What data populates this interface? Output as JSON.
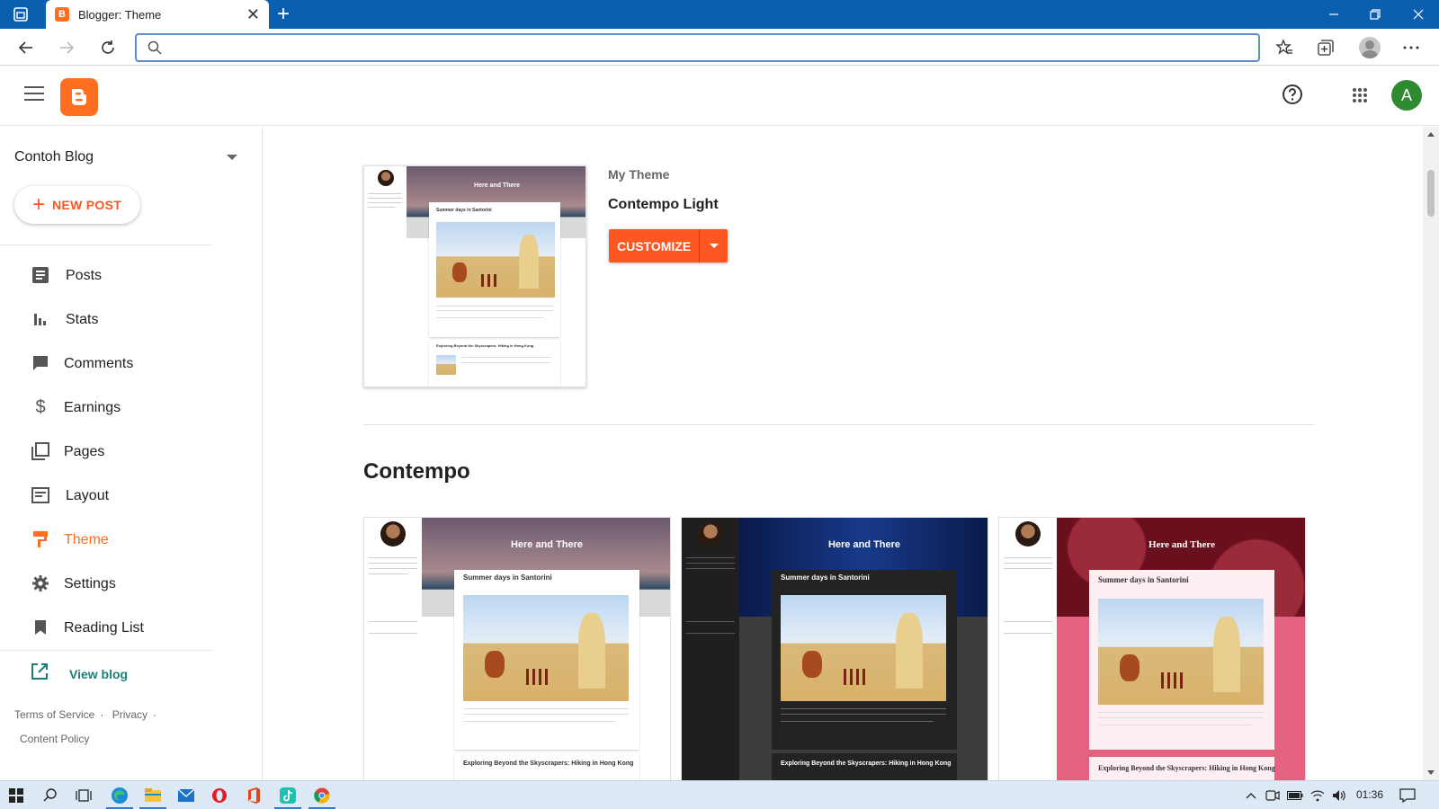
{
  "browser": {
    "tab_title": "Blogger: Theme",
    "address_value": "",
    "address_placeholder": ""
  },
  "header": {
    "user_initial": "A"
  },
  "sidebar": {
    "blog_name": "Contoh Blog",
    "new_post_label": "NEW POST",
    "items": [
      {
        "label": "Posts",
        "icon": "posts-icon"
      },
      {
        "label": "Stats",
        "icon": "stats-icon"
      },
      {
        "label": "Comments",
        "icon": "comments-icon"
      },
      {
        "label": "Earnings",
        "icon": "earnings-icon"
      },
      {
        "label": "Pages",
        "icon": "pages-icon"
      },
      {
        "label": "Layout",
        "icon": "layout-icon"
      },
      {
        "label": "Theme",
        "icon": "theme-icon",
        "active": true
      },
      {
        "label": "Settings",
        "icon": "settings-icon"
      },
      {
        "label": "Reading List",
        "icon": "reading-list-icon"
      }
    ],
    "view_blog_label": "View blog",
    "footer": {
      "terms": "Terms of Service",
      "privacy": "Privacy",
      "content_policy": "Content Policy"
    }
  },
  "main": {
    "my_theme_label": "My Theme",
    "my_theme_name": "Contempo Light",
    "customize_label": "CUSTOMIZE",
    "section_title": "Contempo",
    "thumb": {
      "blog_title": "Here and There",
      "post_title": "Summer days in Santorini",
      "post2_title": "Exploring Beyond the Skyscrapers: Hiking in Hong Kong"
    }
  },
  "taskbar": {
    "time": "01:36"
  },
  "colors": {
    "accent": "#ff5722",
    "brand": "#ff6d1f",
    "link": "#1b7e7a",
    "browser_chrome": "#0b5fb0"
  }
}
